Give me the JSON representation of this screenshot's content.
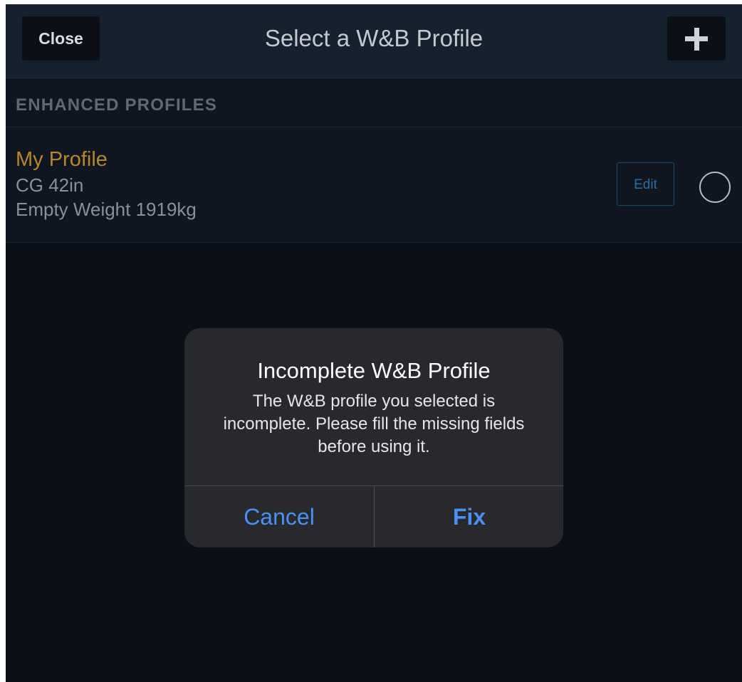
{
  "header": {
    "close_label": "Close",
    "title": "Select a W&B Profile",
    "add_icon": "plus-icon"
  },
  "section": {
    "title": "ENHANCED PROFILES"
  },
  "profile": {
    "name": "My Profile",
    "cg": "CG 42in",
    "empty_weight": "Empty Weight 1919kg",
    "edit_label": "Edit",
    "selected": false
  },
  "dialog": {
    "title": "Incomplete W&B Profile",
    "message": "The W&B profile you selected is incomplete. Please fill the missing fields before using it.",
    "cancel_label": "Cancel",
    "fix_label": "Fix"
  },
  "colors": {
    "background": "#0b0f16",
    "header": "#162130",
    "profile_name": "#b5862c",
    "accent_blue": "#4d8ff2",
    "dialog": "#27292d"
  }
}
